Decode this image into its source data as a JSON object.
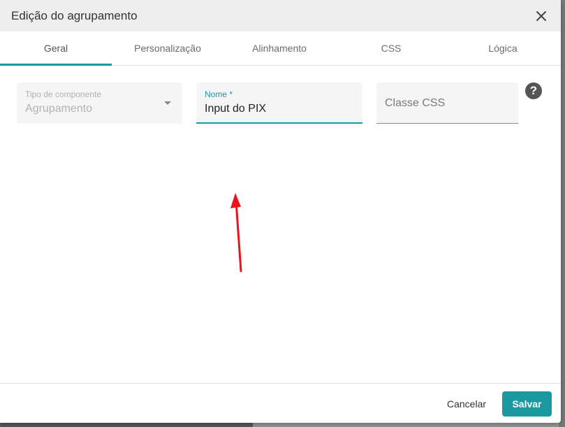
{
  "dialog": {
    "title": "Edição do agrupamento",
    "close_icon": "close-icon"
  },
  "tabs": [
    {
      "label": "Geral",
      "active": true
    },
    {
      "label": "Personalização",
      "active": false
    },
    {
      "label": "Alinhamento",
      "active": false
    },
    {
      "label": "CSS",
      "active": false
    },
    {
      "label": "Lógica",
      "active": false
    }
  ],
  "fields": {
    "tipo": {
      "label": "Tipo de componente",
      "value": "Agrupamento",
      "disabled": true
    },
    "nome": {
      "label": "Nome *",
      "value": "Input do PIX"
    },
    "classe_css": {
      "placeholder": "Classe CSS"
    }
  },
  "help_icon": "help-circle-icon",
  "annotation": {
    "icon": "red-arrow",
    "color": "#e8141b"
  },
  "footer": {
    "cancel_label": "Cancelar",
    "save_label": "Salvar"
  },
  "colors": {
    "accent": "#1a9aa0"
  }
}
